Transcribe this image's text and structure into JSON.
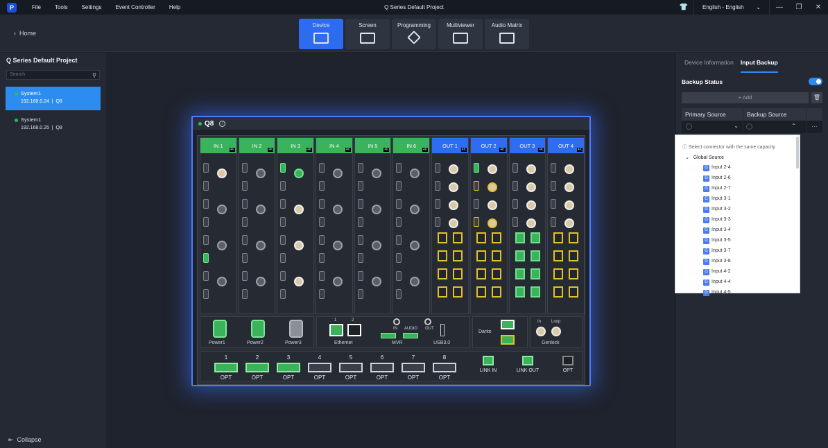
{
  "menubar": {
    "items": [
      "File",
      "Tools",
      "Settings",
      "Event Controller",
      "Help"
    ],
    "title": "Q Series Default Project",
    "language": "English - English"
  },
  "toolbar": {
    "home": "Home",
    "tabs": [
      "Device",
      "Screen",
      "Programming",
      "Multiviewer",
      "Audio Matrix"
    ]
  },
  "sidebar": {
    "project": "Q Series Default Project",
    "search_placeholder": "Search",
    "systems": [
      {
        "name": "System1",
        "ip": "192.168.0.24",
        "model": "Q8"
      },
      {
        "name": "System1",
        "ip": "192.168.0.25",
        "model": "Q8"
      }
    ],
    "collapse": "Collapse"
  },
  "device": {
    "name": "Q8",
    "inputs": [
      "IN 1",
      "IN 2",
      "IN 3",
      "IN 4",
      "IN 5",
      "IN 6"
    ],
    "outputs": [
      "OUT 1",
      "OUT 2",
      "OUT 3",
      "OUT 4"
    ],
    "badge": "4K",
    "power": [
      "Power1",
      "Power2",
      "Power3"
    ],
    "ethernet": "Ethernet",
    "eth_nums": [
      "1",
      "2"
    ],
    "mvr": "MVR",
    "audio": "AUDIO",
    "in": "IN",
    "out": "OUT",
    "usb": "USB3.0",
    "dante": "Dante",
    "genlock": "Genlock",
    "genlock_in": "In",
    "genlock_loop": "Loop",
    "opt_nums": [
      "1",
      "2",
      "3",
      "4",
      "5",
      "6",
      "7",
      "8"
    ],
    "opt": "OPT",
    "link_in": "LINK IN",
    "link_out": "LINK OUT"
  },
  "right_panel": {
    "tabs": [
      "Device Information",
      "Input Backup"
    ],
    "backup_status": "Backup Status",
    "add": "+ Add",
    "primary": "Primary Source",
    "backup": "Backup Source",
    "more": "···",
    "dropdown": {
      "hint": "Select connector with the same capacity",
      "group": "Global Source",
      "items": [
        "Input 2-4",
        "Input 2-6",
        "Input 2-7",
        "Input 3-1",
        "Input 3-2",
        "Input 3-3",
        "Input 3-4",
        "Input 3-5",
        "Input 3-7",
        "Input 3-8",
        "Input 4-2",
        "Input 4-4",
        "Input 4-5"
      ]
    }
  },
  "colors": {
    "accent": "#2d8cf0",
    "green": "#3bb35a",
    "yellow": "#e4c12a",
    "out_blue": "#2e6cf0"
  }
}
